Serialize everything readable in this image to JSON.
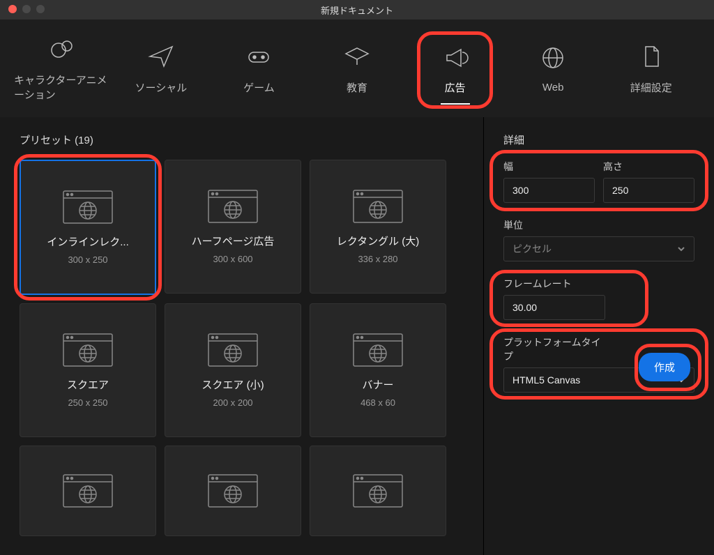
{
  "title": "新規ドキュメント",
  "tabs": [
    {
      "label": "キャラクターアニメーション"
    },
    {
      "label": "ソーシャル"
    },
    {
      "label": "ゲーム"
    },
    {
      "label": "教育"
    },
    {
      "label": "広告"
    },
    {
      "label": "Web"
    },
    {
      "label": "詳細設定"
    }
  ],
  "presets_label": "プリセット (19)",
  "presets": [
    {
      "name": "インラインレク...",
      "dim": "300 x 250"
    },
    {
      "name": "ハーフページ広告",
      "dim": "300 x 600"
    },
    {
      "name": "レクタングル (大)",
      "dim": "336 x 280"
    },
    {
      "name": "スクエア",
      "dim": "250 x 250"
    },
    {
      "name": "スクエア (小)",
      "dim": "200 x 200"
    },
    {
      "name": "バナー",
      "dim": "468 x 60"
    }
  ],
  "detail": {
    "title": "詳細",
    "width_label": "幅",
    "width": "300",
    "height_label": "高さ",
    "height": "250",
    "unit_label": "単位",
    "unit": "ピクセル",
    "fps_label": "フレームレート",
    "fps": "30.00",
    "platform_label": "プラットフォームタイプ",
    "platform": "HTML5 Canvas"
  },
  "create": "作成"
}
